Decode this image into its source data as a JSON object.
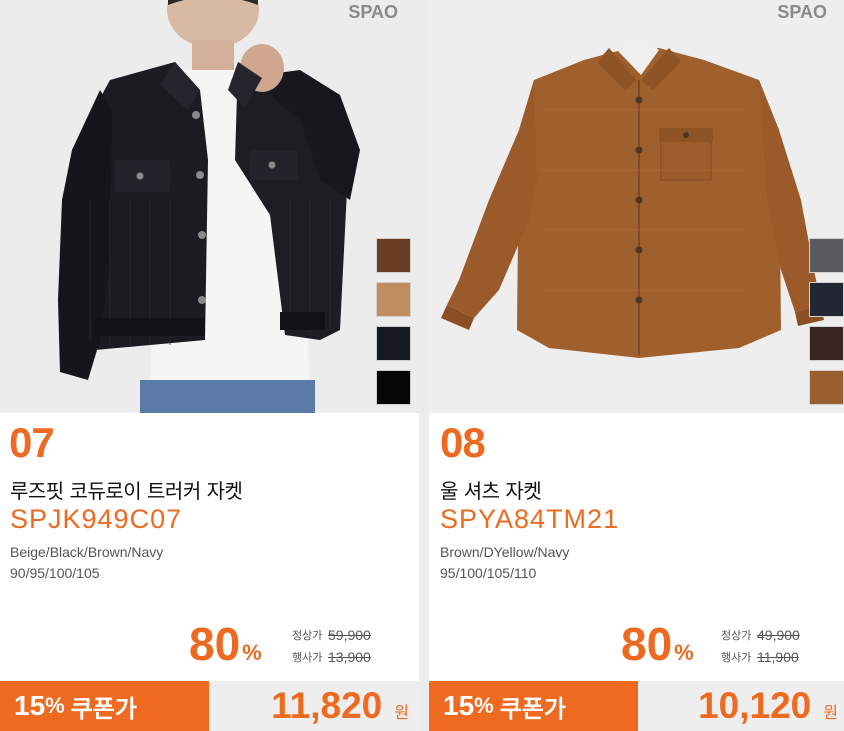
{
  "products": [
    {
      "brand": "SPAO",
      "number": "07",
      "name": "루즈핏 코듀로이 트러커 자켓",
      "code": "SPJK949C07",
      "colors": "Beige/Black/Brown/Navy",
      "sizes": "90/95/100/105",
      "swatches": [
        "#6b3d22",
        "#c08e5e",
        "#171a22",
        "#050505"
      ],
      "discount": "80",
      "discount_sign": "%",
      "regular_label": "정상가",
      "regular_price": "59,900",
      "sale_label": "행사가",
      "sale_price": "13,900",
      "coupon_num": "15",
      "coupon_sign": "%",
      "coupon_label": "쿠폰가",
      "coupon_price": "11,820",
      "currency": "원"
    },
    {
      "brand": "SPAO",
      "number": "08",
      "name": "울 셔츠 자켓",
      "code": "SPYA84TM21",
      "colors": "Brown/DYellow/Navy",
      "sizes": "95/100/105/110",
      "swatches": [
        "#5a5b5e",
        "#232633",
        "#3a2620",
        "#9a5f2e"
      ],
      "discount": "80",
      "discount_sign": "%",
      "regular_label": "정상가",
      "regular_price": "49,900",
      "sale_label": "행사가",
      "sale_price": "11,900",
      "coupon_num": "15",
      "coupon_sign": "%",
      "coupon_label": "쿠폰가",
      "coupon_price": "10,120",
      "currency": "원"
    }
  ],
  "colors": {
    "accent": "#ee6a21",
    "corduroy_jacket": "#1b1c22",
    "wool_shirt": "#a0602e"
  }
}
